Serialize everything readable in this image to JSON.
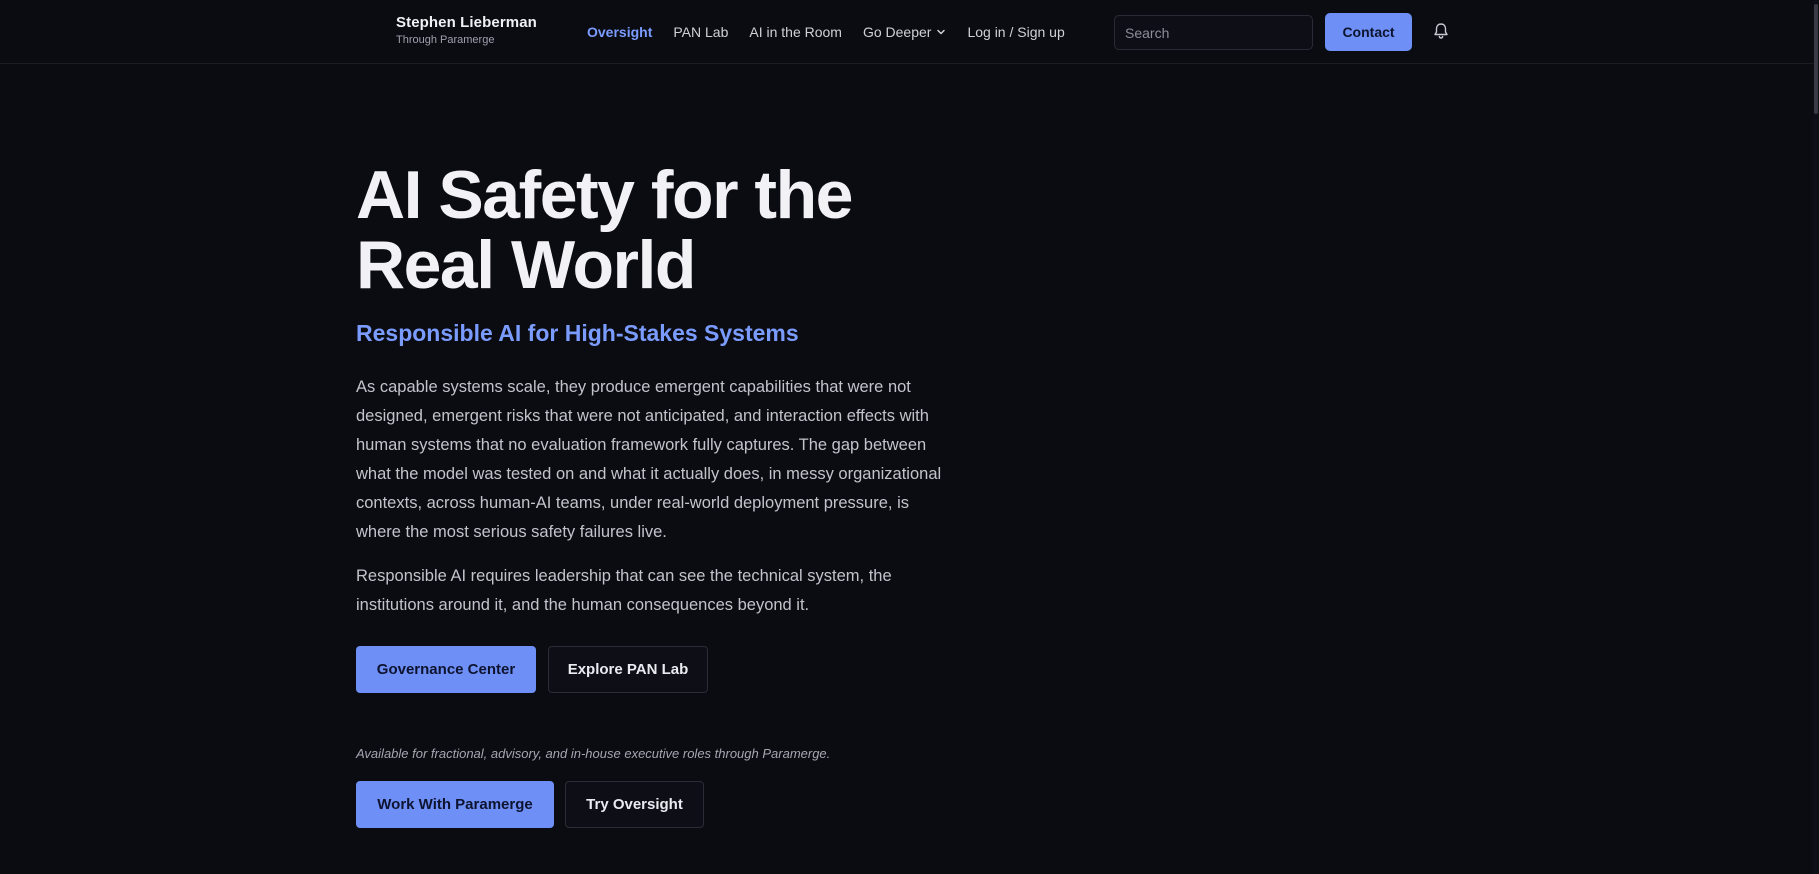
{
  "header": {
    "brand_name": "Stephen Lieberman",
    "brand_sub": "Through Paramerge",
    "nav": [
      {
        "label": "Oversight",
        "active": true
      },
      {
        "label": "PAN Lab",
        "active": false
      },
      {
        "label": "AI in the Room",
        "active": false
      },
      {
        "label": "Go Deeper",
        "active": false,
        "icon": "chevron-down-icon"
      },
      {
        "label": "Log in / Sign up",
        "active": false
      }
    ],
    "search_placeholder": "Search",
    "search_value": "",
    "contact_label": "Contact",
    "bell_icon": "bell-icon"
  },
  "hero": {
    "title_line1": "AI Safety for the",
    "title_line2": "Real World",
    "subtitle": "Responsible AI for High-Stakes Systems",
    "paragraph1": "As capable systems scale, they produce emergent capabilities that were not designed, emergent risks that were not anticipated, and interaction effects with human systems that no evaluation framework fully captures. The gap between what the model was tested on and what it actually does, in messy organizational contexts, across human-AI teams, under real-world deployment pressure, is where the most serious safety failures live.",
    "paragraph2": "Responsible AI requires leadership that can see the technical system, the institutions around it, and the human consequences beyond it.",
    "buttons_primary_row": {
      "governance_label": "Governance Center",
      "pan_label": "Explore PAN Lab"
    },
    "note": "Available for fractional, advisory, and in-house executive roles through Paramerge.",
    "buttons_secondary_row": {
      "work_label": "Work With Paramerge",
      "try_label": "Try Oversight"
    }
  },
  "colors": {
    "background": "#0b0b12",
    "accent": "#6e8ff5",
    "accent_text": "#7b9cff"
  }
}
